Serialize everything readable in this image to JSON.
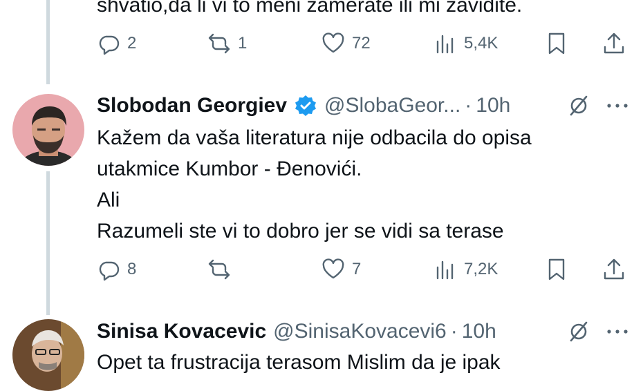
{
  "prev_tweet": {
    "text_fragment": "shvatio,da li vi to meni zamerate ili mi zavidite.",
    "replies": "2",
    "reposts": "1",
    "likes": "72",
    "views": "5,4K"
  },
  "tweet1": {
    "name": "Slobodan Georgiev",
    "handle": "@SlobaGeor...",
    "dot": "·",
    "time": "10h",
    "lines": [
      "Kažem da vaša literatura nije odbacila do opisa",
      "utakmice Kumbor - Đenovići.",
      "Ali",
      "Razumeli ste vi to dobro jer se vidi sa terase"
    ],
    "replies": "8",
    "reposts": "",
    "likes": "7",
    "views": "7,2K",
    "verified_color": "#1d9bf0"
  },
  "tweet2": {
    "name": "Sinisa Kovacevic",
    "handle": "@SinisaKovacevi6",
    "dot": "·",
    "time": "10h",
    "text_fragment": "Opet ta frustracija terasom Mislim da je ipak"
  },
  "icons": {
    "reply": "reply-icon",
    "repost": "repost-icon",
    "like": "heart-icon",
    "views": "views-icon",
    "bookmark": "bookmark-icon",
    "share": "share-icon",
    "grok": "grok-icon",
    "more": "more-icon"
  },
  "colors": {
    "text": "#0f1419",
    "secondary": "#536471",
    "thread_line": "#cfd9de",
    "verified": "#1d9bf0"
  }
}
